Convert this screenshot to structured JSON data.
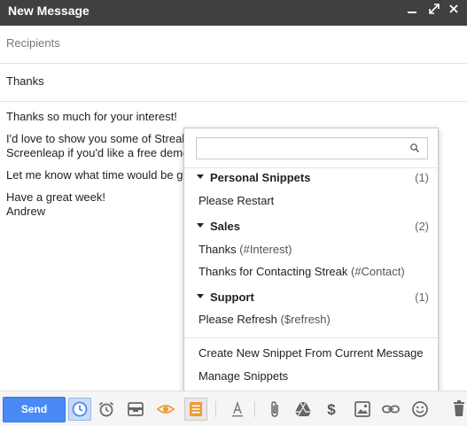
{
  "window": {
    "title": "New Message",
    "controls": [
      "minimize-icon",
      "popout-icon",
      "close-icon"
    ]
  },
  "compose": {
    "recipients_placeholder": "Recipients",
    "subject": "Thanks",
    "body": {
      "line1": "Thanks so much for your interest!",
      "line2": "I'd love to show you some of Streak",
      "line3": "Screenleap if you'd like a free demo",
      "line4": "Let me know what time would be go",
      "line5": "Have a great week!",
      "line6": "Andrew"
    }
  },
  "snippets_popup": {
    "search_value": "",
    "groups": [
      {
        "name": "Personal Snippets",
        "count": "(1)"
      },
      {
        "name": "Sales",
        "count": "(2)"
      },
      {
        "name": "Support",
        "count": "(1)"
      }
    ],
    "items": {
      "personal_1": {
        "title": "Please Restart",
        "shortcut": ""
      },
      "sales_1": {
        "title": "Thanks",
        "shortcut": "(#Interest)"
      },
      "sales_2": {
        "title": "Thanks for Contacting Streak",
        "shortcut": "(#Contact)"
      },
      "support_1": {
        "title": "Please Refresh",
        "shortcut": "($refresh)"
      }
    },
    "actions": {
      "create": "Create New Snippet From Current Message",
      "manage": "Manage Snippets"
    }
  },
  "toolbar": {
    "send_label": "Send",
    "icons": [
      "send-later-icon",
      "reminder-icon",
      "snooze-icon",
      "tracking-eye-icon",
      "snippets-icon",
      "formatting-icon",
      "attach-icon",
      "drive-icon",
      "money-icon",
      "photo-icon",
      "link-icon",
      "emoji-icon",
      "discard-icon"
    ]
  },
  "colors": {
    "titlebar": "#404040",
    "send_button": "#4a8af4",
    "accent_orange": "#f29a2e"
  }
}
